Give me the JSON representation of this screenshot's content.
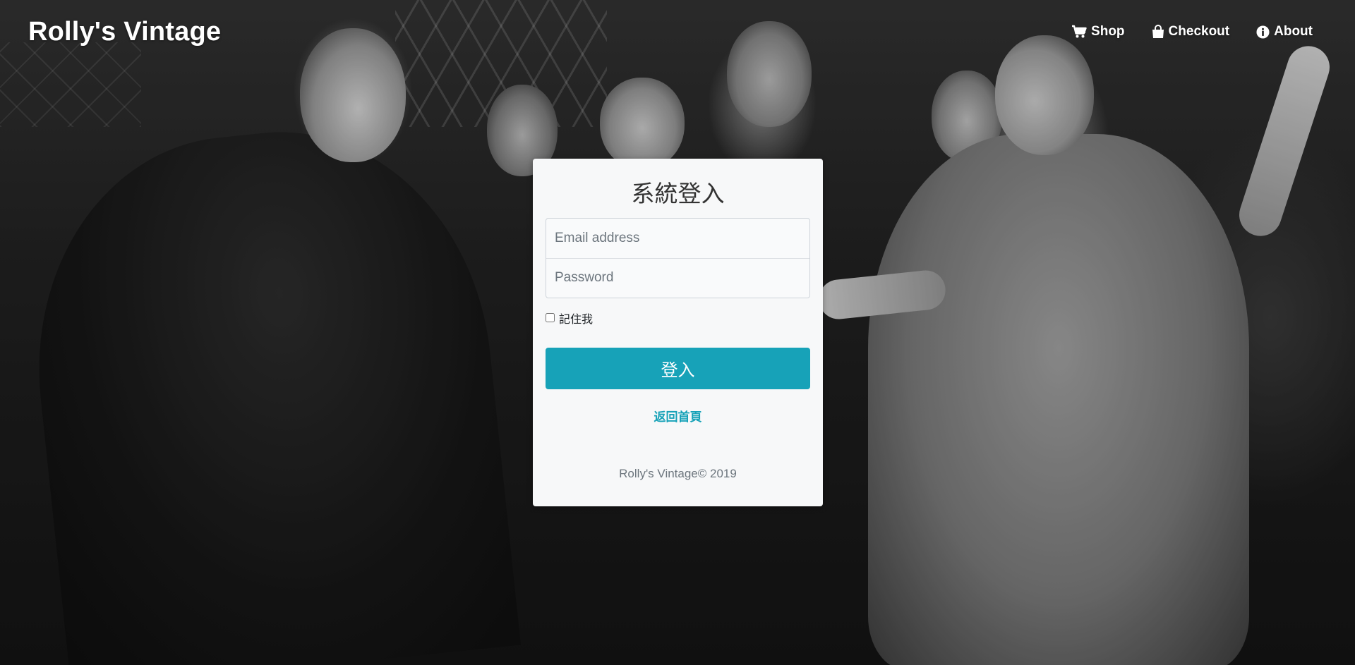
{
  "nav": {
    "brand": "Rolly's Vintage",
    "links": [
      {
        "label": "Shop",
        "icon": "shopping-cart-icon"
      },
      {
        "label": "Checkout",
        "icon": "shopping-bag-icon"
      },
      {
        "label": "About",
        "icon": "info-circle-icon"
      }
    ]
  },
  "login": {
    "title": "系統登入",
    "email_placeholder": "Email address",
    "password_placeholder": "Password",
    "remember_label": "記住我",
    "submit_label": "登入",
    "back_link": "返回首頁",
    "footer": "Rolly's Vintage© 2019"
  },
  "colors": {
    "accent": "#17a2b8",
    "card_background": "#f7f8f9",
    "nav_text": "#ffffff"
  }
}
